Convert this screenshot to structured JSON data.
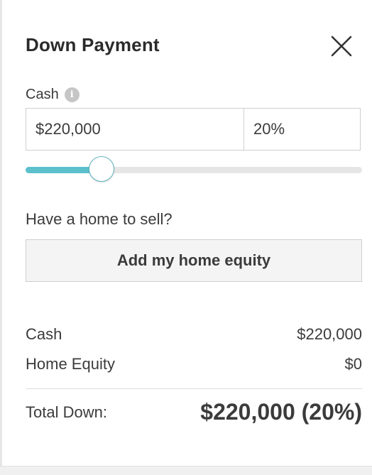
{
  "header": {
    "title": "Down Payment",
    "close_icon": "close-icon"
  },
  "cash_input": {
    "label": "Cash",
    "info_icon": "info-icon",
    "info_glyph": "i",
    "amount_value": "$220,000",
    "percent_value": "20%"
  },
  "slider": {
    "level_fraction": 0.225,
    "accent_color": "#5cc0cc"
  },
  "home_equity": {
    "question": "Have a home to sell?",
    "button_label": "Add my home equity"
  },
  "summary": {
    "cash_label": "Cash",
    "cash_value": "$220,000",
    "equity_label": "Home Equity",
    "equity_value": "$0",
    "total_label": "Total Down:",
    "total_value": "$220,000 (20%)"
  }
}
